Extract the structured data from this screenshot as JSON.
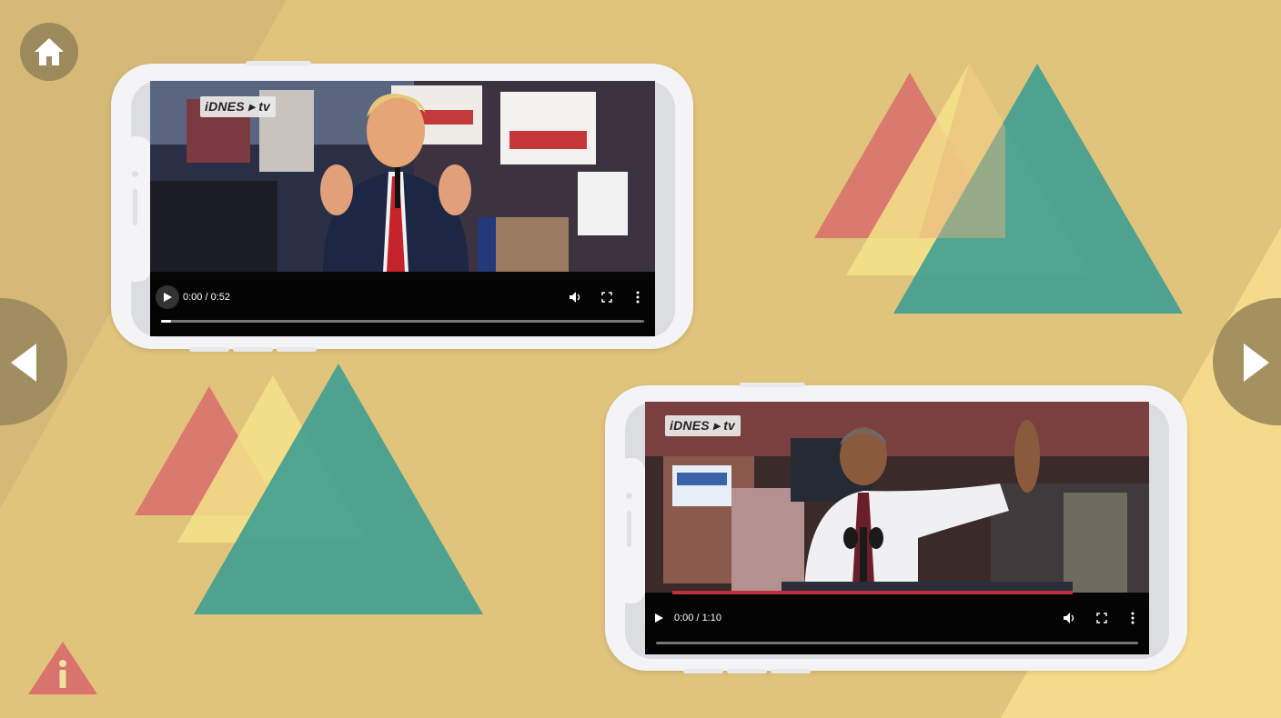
{
  "navigation": {
    "home_icon": "home-icon",
    "prev_icon": "chevron-left-icon",
    "next_icon": "chevron-right-icon",
    "info_icon": "info-icon"
  },
  "colors": {
    "background": "#e0c47c",
    "triangle_red": "#d9736d",
    "triangle_yellow": "#f3e38a",
    "triangle_teal": "#3e9e91"
  },
  "videos": [
    {
      "brand": "iDNES ▸ tv",
      "time": "0:00 / 0:52",
      "progress": 0.02,
      "icons": [
        "play-icon",
        "volume-icon",
        "fullscreen-icon",
        "more-icon"
      ]
    },
    {
      "brand": "iDNES ▸ tv",
      "time": "0:00 / 1:10",
      "progress": 0.0,
      "icons": [
        "play-icon",
        "volume-icon",
        "fullscreen-icon",
        "more-icon"
      ]
    }
  ]
}
